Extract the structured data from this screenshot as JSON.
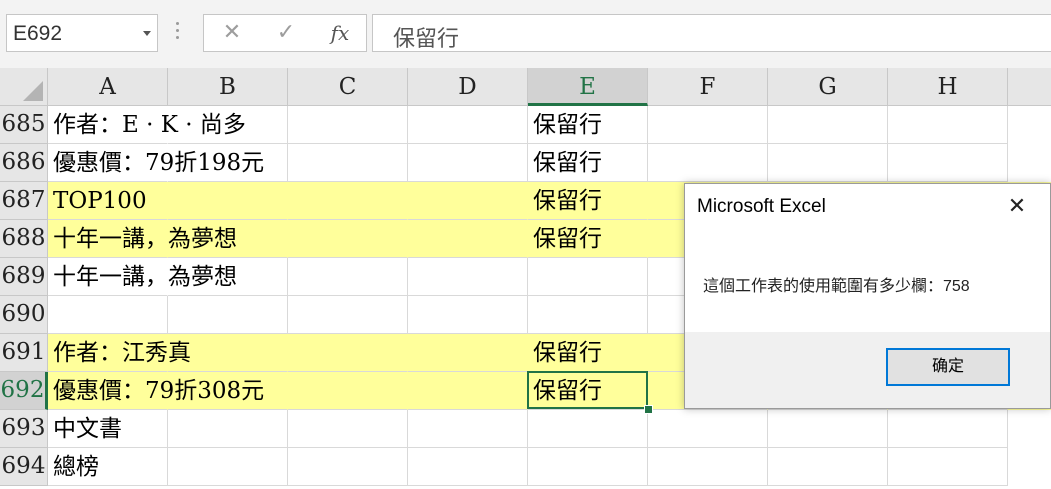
{
  "formula_bar": {
    "name_box": "E692",
    "cancel_icon": "✕",
    "enter_icon": "✓",
    "fx_label": "fx",
    "content": "保留行"
  },
  "columns": [
    "A",
    "B",
    "C",
    "D",
    "E",
    "F",
    "G",
    "H"
  ],
  "rows": [
    {
      "num": "685",
      "a": "作者：E · K · 尚多",
      "e": "保留行"
    },
    {
      "num": "686",
      "a": "優惠價：79折198元",
      "e": "保留行"
    },
    {
      "num": "687",
      "a": "TOP100",
      "e": "保留行"
    },
    {
      "num": "688",
      "a": "十年一講，為夢想",
      "e": "保留行"
    },
    {
      "num": "689",
      "a": "十年一講，為夢想",
      "e": ""
    },
    {
      "num": "690",
      "a": "",
      "e": ""
    },
    {
      "num": "691",
      "a": "作者：江秀真",
      "e": "保留行"
    },
    {
      "num": "692",
      "a": "優惠價：79折308元",
      "e": "保留行"
    },
    {
      "num": "693",
      "a": "中文書",
      "e": ""
    },
    {
      "num": "694",
      "a": "總榜",
      "e": ""
    }
  ],
  "highlight_color": "#ffff9b",
  "accent_color": "#217346",
  "dialog": {
    "title": "Microsoft Excel",
    "message": "這個工作表的使用範圍有多少欄：758",
    "ok_label": "确定"
  }
}
